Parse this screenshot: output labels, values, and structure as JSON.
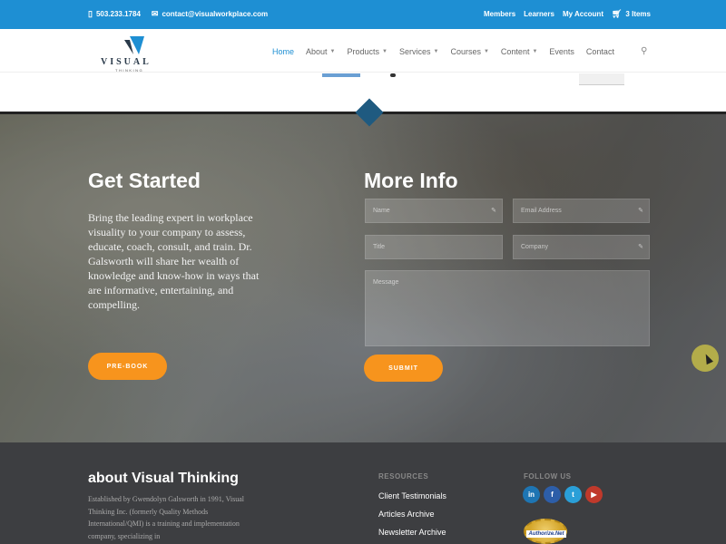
{
  "topbar": {
    "phone": "503.233.1784",
    "email": "contact@visualworkplace.com",
    "links": [
      "Members",
      "Learners",
      "My Account"
    ],
    "cart": "3 Items"
  },
  "logo": {
    "word": "VISUAL",
    "sub": "THINKING"
  },
  "nav": [
    {
      "label": "Home",
      "active": true,
      "dropdown": false
    },
    {
      "label": "About",
      "active": false,
      "dropdown": true
    },
    {
      "label": "Products",
      "active": false,
      "dropdown": true
    },
    {
      "label": "Services",
      "active": false,
      "dropdown": true
    },
    {
      "label": "Courses",
      "active": false,
      "dropdown": true
    },
    {
      "label": "Content",
      "active": false,
      "dropdown": true
    },
    {
      "label": "Events",
      "active": false,
      "dropdown": false
    },
    {
      "label": "Contact",
      "active": false,
      "dropdown": false
    }
  ],
  "get_started": {
    "title": "Get Started",
    "body": "Bring the leading expert in workplace visuality to your company to assess, educate, coach, consult, and train. Dr. Galsworth will share her wealth of knowledge and know-how in ways that are informative, entertaining, and compelling.",
    "button": "PRE-BOOK"
  },
  "more_info": {
    "title": "More Info",
    "name_placeholder": "Name",
    "email_placeholder": "Email Address",
    "title_placeholder": "Title",
    "company_placeholder": "Company",
    "message_placeholder": "Message",
    "submit": "SUBMIT"
  },
  "footer": {
    "about_title": "about Visual Thinking",
    "about_body": "Established by Gwendolyn Galsworth in 1991, Visual Thinking Inc. (formerly Quality Methods International/QMI) is a training and implementation company, specializing in",
    "resources_head": "RESOURCES",
    "resources": [
      "Client Testimonials",
      "Articles Archive",
      "Newsletter Archive"
    ],
    "follow_head": "FOLLOW US",
    "socials": [
      {
        "name": "linkedin-icon",
        "glyph": "in",
        "color": "#1e75b3"
      },
      {
        "name": "facebook-icon",
        "glyph": "f",
        "color": "#2d5ea8"
      },
      {
        "name": "twitter-icon",
        "glyph": "t",
        "color": "#2a9fd8"
      },
      {
        "name": "youtube-icon",
        "glyph": "▶",
        "color": "#c0392b"
      }
    ],
    "badge": "Authorize.Net"
  },
  "colors": {
    "accent": "#1e8fd3",
    "button": "#f7941d",
    "footer": "#3d3e41"
  }
}
